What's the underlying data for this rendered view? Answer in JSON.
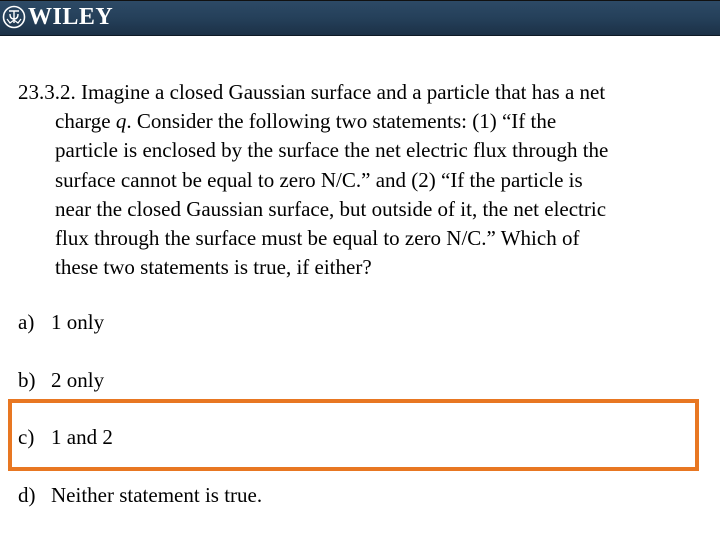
{
  "header": {
    "brand": "WILEY",
    "logo_icon": "wiley-logo-icon",
    "background_color": "#25405a"
  },
  "question": {
    "number": "23.3.2.",
    "lines": [
      "23.3.2. Imagine a closed Gaussian surface and a particle that has a net",
      "charge ",
      "particle is enclosed by the surface the net electric flux through the",
      "surface cannot be equal to zero N/C.” and (2) “If the particle is",
      "near the closed Gaussian surface, but outside of it, the net electric",
      "flux through the surface must be equal to zero N/C.”  Which of",
      "these two statements is true, if either?"
    ],
    "line2_variable": "q",
    "line2_rest": ".  Consider the following two statements: (1) “If the"
  },
  "options": [
    {
      "letter": "a)",
      "text": "1 only",
      "highlighted": false
    },
    {
      "letter": "b)",
      "text": "2 only",
      "highlighted": false
    },
    {
      "letter": "c)",
      "text": "1 and 2",
      "highlighted": true
    },
    {
      "letter": "d)",
      "text": "Neither statement is true.",
      "highlighted": false
    }
  ],
  "highlight": {
    "color": "#e87722",
    "selected_option": "c)"
  }
}
